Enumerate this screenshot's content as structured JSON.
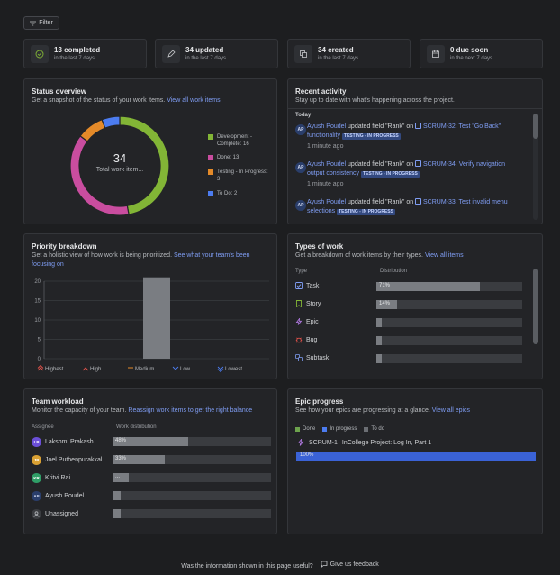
{
  "toolbar": {
    "filter_label": "Filter"
  },
  "stats": [
    {
      "icon": "check-circle-icon",
      "title": "13 completed",
      "subtitle": "in the last 7 days"
    },
    {
      "icon": "pencil-icon",
      "title": "34 updated",
      "subtitle": "in the last 7 days"
    },
    {
      "icon": "copy-icon",
      "title": "34 created",
      "subtitle": "in the last 7 days"
    },
    {
      "icon": "calendar-icon",
      "title": "0 due soon",
      "subtitle": "in the next 7 days"
    }
  ],
  "status_overview": {
    "title": "Status overview",
    "subtitle": "Get a snapshot of the status of your work items.",
    "link": "View all work items",
    "center_value": "34",
    "center_label": "Total work item...",
    "legend": [
      {
        "label": "Development - Complete: 16",
        "color": "#82b536"
      },
      {
        "label": "Done: 13",
        "color": "#c94d9f"
      },
      {
        "label": "Testing - In Progress: 3",
        "color": "#e48a29"
      },
      {
        "label": "To Do: 2",
        "color": "#4c7cf0"
      }
    ],
    "chart_data": {
      "type": "pie",
      "categories": [
        "Development - Complete",
        "Done",
        "Testing - In Progress",
        "To Do"
      ],
      "values": [
        16,
        13,
        3,
        2
      ]
    }
  },
  "recent_activity": {
    "title": "Recent activity",
    "subtitle": "Stay up to date with what's happening across the project.",
    "group_label": "Today",
    "items": [
      {
        "initials": "AP",
        "user": "Ayush Poudel",
        "action": "updated field \"Rank\" on",
        "issue": "SCRUM-32: Test \"Go Back\" functionality",
        "status": "TESTING - IN PROGRESS",
        "time": "1 minute ago"
      },
      {
        "initials": "AP",
        "user": "Ayush Poudel",
        "action": "updated field \"Rank\" on",
        "issue": "SCRUM-34: Verify navigation output consistency",
        "status": "TESTING - IN PROGRESS",
        "time": "1 minute ago"
      },
      {
        "initials": "AP",
        "user": "Ayush Poudel",
        "action": "updated field \"Rank\" on",
        "issue": "SCRUM-33: Test invalid menu selections",
        "status": "TESTING - IN PROGRESS",
        "time": ""
      }
    ]
  },
  "priority_breakdown": {
    "title": "Priority breakdown",
    "subtitle": "Get a holistic view of how work is being prioritized.",
    "link": "See what your team's been focusing on",
    "chart_data": {
      "type": "bar",
      "categories": [
        "Highest",
        "High",
        "Medium",
        "Low",
        "Lowest"
      ],
      "values": [
        0,
        0,
        21,
        0,
        0
      ],
      "ylim": [
        0,
        20
      ],
      "yticks": [
        "0",
        "5",
        "10",
        "15",
        "20"
      ],
      "grid": true
    }
  },
  "types_of_work": {
    "title": "Types of work",
    "subtitle": "Get a breakdown of work items by their types.",
    "link": "View all items",
    "col_type": "Type",
    "col_dist": "Distribution",
    "rows": [
      {
        "icon": "task-icon",
        "label": "Task",
        "percent": 71,
        "text": "71%"
      },
      {
        "icon": "story-icon",
        "label": "Story",
        "percent": 14,
        "text": "14%"
      },
      {
        "icon": "epic-icon",
        "label": "Epic",
        "percent": 4,
        "text": ""
      },
      {
        "icon": "bug-icon",
        "label": "Bug",
        "percent": 4,
        "text": ""
      },
      {
        "icon": "subtask-icon",
        "label": "Subtask",
        "percent": 4,
        "text": ""
      }
    ]
  },
  "team_workload": {
    "title": "Team workload",
    "subtitle": "Monitor the capacity of your team.",
    "link": "Reassign work items to get the right balance",
    "col_assignee": "Assignee",
    "col_dist": "Work distribution",
    "rows": [
      {
        "initials": "LP",
        "color": "#6b4fd8",
        "name": "Lakshmi Prakash",
        "percent": 48,
        "text": "48%"
      },
      {
        "initials": "JP",
        "color": "#d9a033",
        "name": "Joel Puthenpurakkal",
        "percent": 33,
        "text": "33%"
      },
      {
        "initials": "KR",
        "color": "#2f9e67",
        "name": "Kritvi Rai",
        "percent": 10,
        "text": "..."
      },
      {
        "initials": "AP",
        "color": "#2a3e6b",
        "name": "Ayush Poudel",
        "percent": 5,
        "text": ""
      },
      {
        "initials": "",
        "color": "#55585d",
        "name": "Unassigned",
        "percent": 5,
        "text": ""
      }
    ]
  },
  "epic_progress": {
    "title": "Epic progress",
    "subtitle": "See how your epics are progressing at a glance.",
    "link": "View all epics",
    "legend": [
      {
        "label": "Done",
        "color": "#6da34d"
      },
      {
        "label": "In progress",
        "color": "#4c7cf0"
      },
      {
        "label": "To do",
        "color": "#6b6e73"
      }
    ],
    "epic_key": "SCRUM-1",
    "epic_name": "InCollege Project: Log In, Part 1",
    "progress_percent": 100,
    "progress_text": "100%"
  },
  "footer": {
    "question": "Was the information shown in this page useful?",
    "feedback": "Give us feedback"
  }
}
